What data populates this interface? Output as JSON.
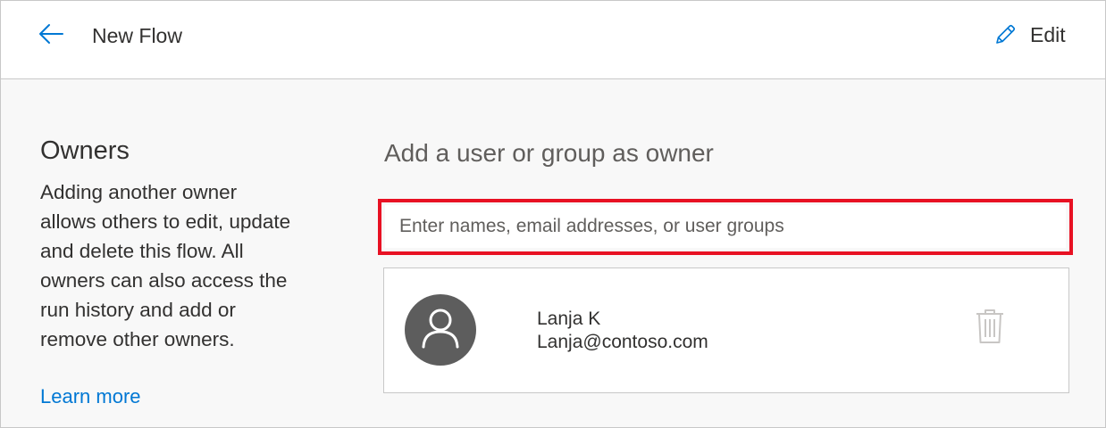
{
  "header": {
    "back_icon": "arrow-left-icon",
    "title": "New Flow",
    "edit_icon": "pencil-icon",
    "edit_label": "Edit",
    "accent_color": "#0078d4"
  },
  "owners_section": {
    "heading": "Owners",
    "description": "Adding another owner allows others to edit, update and delete this flow. All owners can also access the run history and add or remove other owners.",
    "learn_more": "Learn more"
  },
  "add_owner": {
    "heading": "Add a user or group as owner",
    "input_placeholder": "Enter names, email addresses, or user groups",
    "input_value": "",
    "highlight_color": "#e81123"
  },
  "owners": [
    {
      "avatar_icon": "person-icon",
      "name": "Lanja K",
      "email": "Lanja@contoso.com",
      "delete_icon": "trash-icon"
    }
  ]
}
